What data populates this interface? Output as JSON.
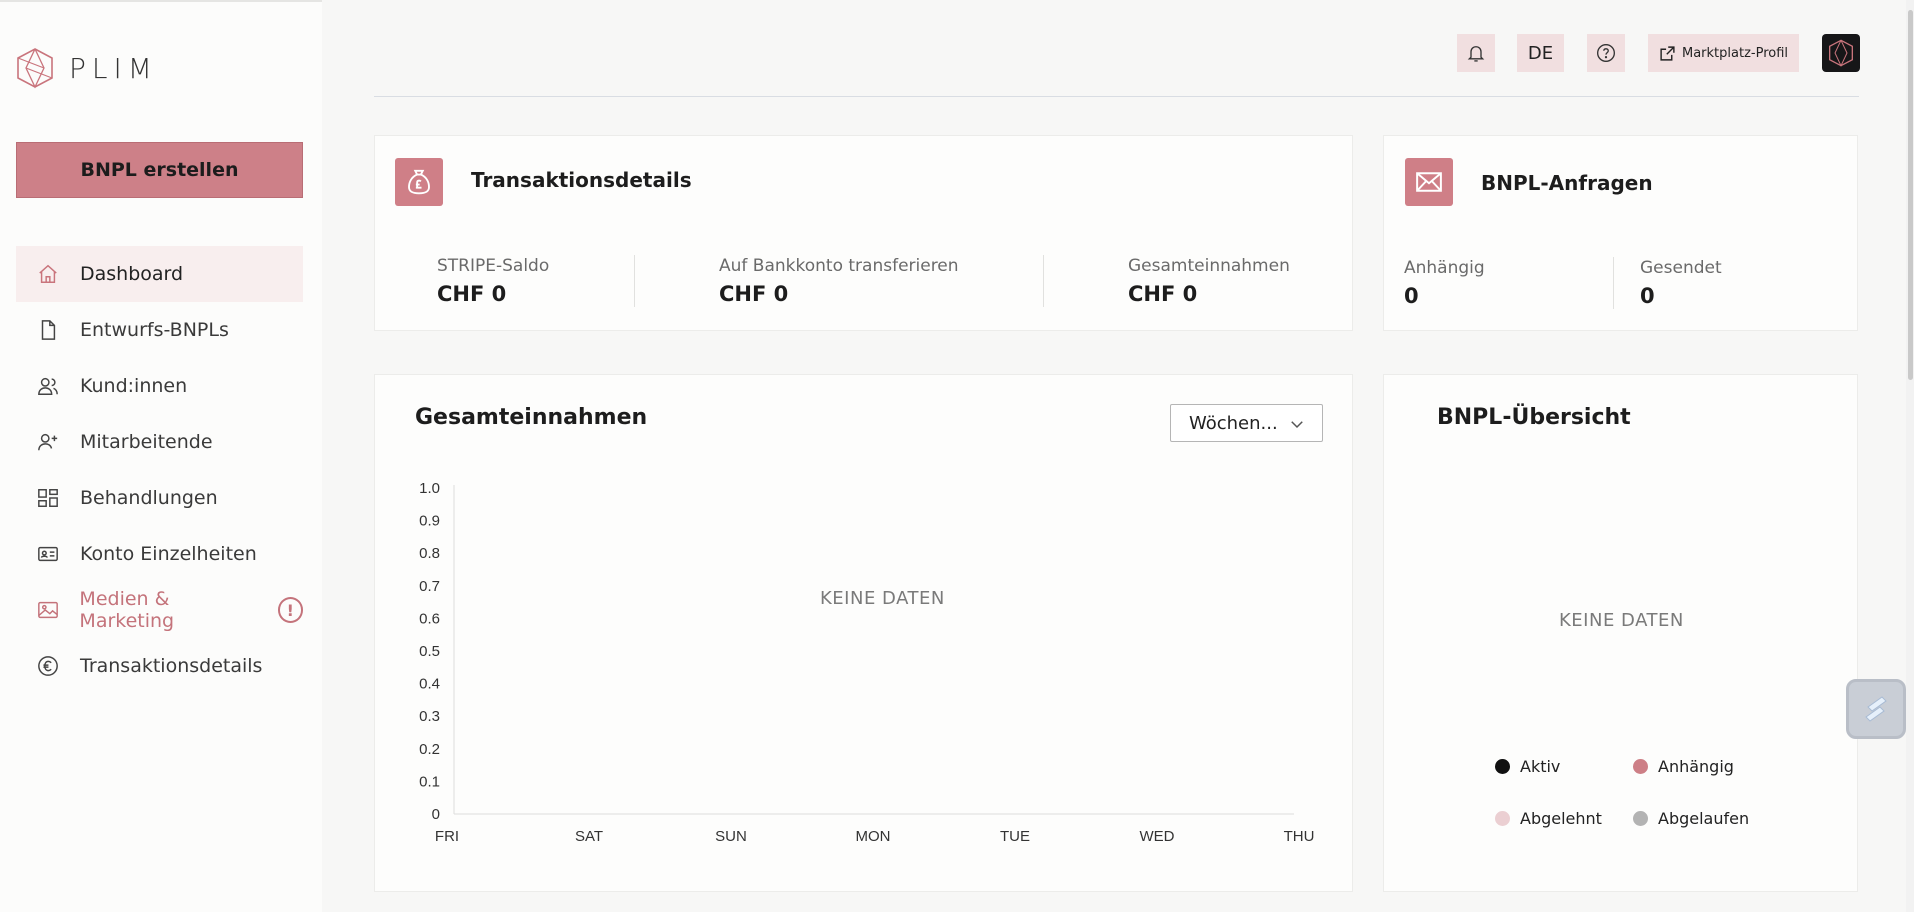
{
  "app": {
    "logo_text": "PLIM"
  },
  "sidebar": {
    "create_button": "BNPL erstellen",
    "items": [
      {
        "label": "Dashboard",
        "icon": "home-icon"
      },
      {
        "label": "Entwurfs-BNPLs",
        "icon": "document-icon"
      },
      {
        "label": "Kund:innen",
        "icon": "users-icon"
      },
      {
        "label": "Mitarbeitende",
        "icon": "user-plus-icon"
      },
      {
        "label": "Behandlungen",
        "icon": "grid-icon"
      },
      {
        "label": "Konto Einzelheiten",
        "icon": "id-card-icon"
      },
      {
        "label": "Medien & Marketing",
        "icon": "image-icon",
        "badge": "!"
      },
      {
        "label": "Transaktionsdetails",
        "icon": "euro-icon"
      }
    ]
  },
  "topbar": {
    "language": "DE",
    "marketplace_label": "Marktplatz-Profil"
  },
  "transactions": {
    "title": "Transaktionsdetails",
    "stats": [
      {
        "label": "STRIPE-Saldo",
        "value": "CHF 0"
      },
      {
        "label": "Auf Bankkonto transferieren",
        "value": "CHF 0"
      },
      {
        "label": "Gesamteinnahmen",
        "value": "CHF 0"
      }
    ]
  },
  "requests": {
    "title": "BNPL-Anfragen",
    "stats": [
      {
        "label": "Anhängig",
        "value": "0"
      },
      {
        "label": "Gesendet",
        "value": "0"
      }
    ]
  },
  "revenue": {
    "title": "Gesamteinnahmen",
    "period_select": "Wöchen...",
    "no_data": "KEINE DATEN"
  },
  "overview": {
    "title": "BNPL-Übersicht",
    "no_data": "KEINE DATEN",
    "legend": [
      {
        "label": "Aktiv",
        "color": "#111111"
      },
      {
        "label": "Anhängig",
        "color": "#cd7f86"
      },
      {
        "label": "Abgelehnt",
        "color": "#ebcfd2"
      },
      {
        "label": "Abgelaufen",
        "color": "#b3b3b3"
      }
    ]
  },
  "chart_data": {
    "type": "line",
    "title": "Gesamteinnahmen",
    "categories": [
      "FRI",
      "SAT",
      "SUN",
      "MON",
      "TUE",
      "WED",
      "THU"
    ],
    "series": [],
    "y_ticks": [
      "1.0",
      "0.9",
      "0.8",
      "0.7",
      "0.6",
      "0.5",
      "0.4",
      "0.3",
      "0.2",
      "0.1",
      "0"
    ],
    "ylim": [
      0,
      1.0
    ],
    "annotation": "KEINE DATEN"
  }
}
